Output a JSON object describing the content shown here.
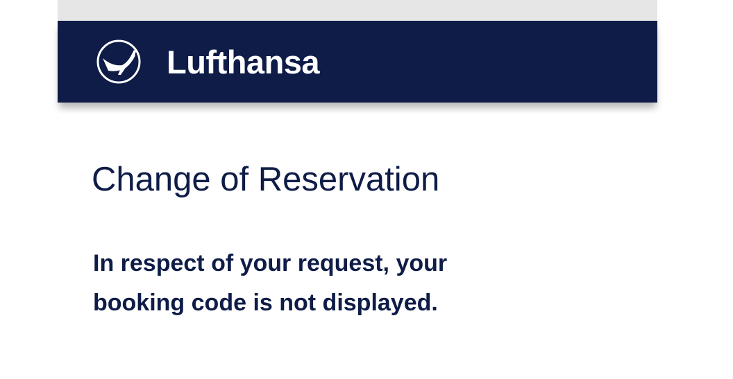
{
  "header": {
    "brand_name": "Lufthansa",
    "logo_icon": "crane-logo-icon",
    "background_color": "#0e1c47"
  },
  "main": {
    "title": "Change of Reservation",
    "message": "In respect of your request, your booking code is not displayed."
  }
}
